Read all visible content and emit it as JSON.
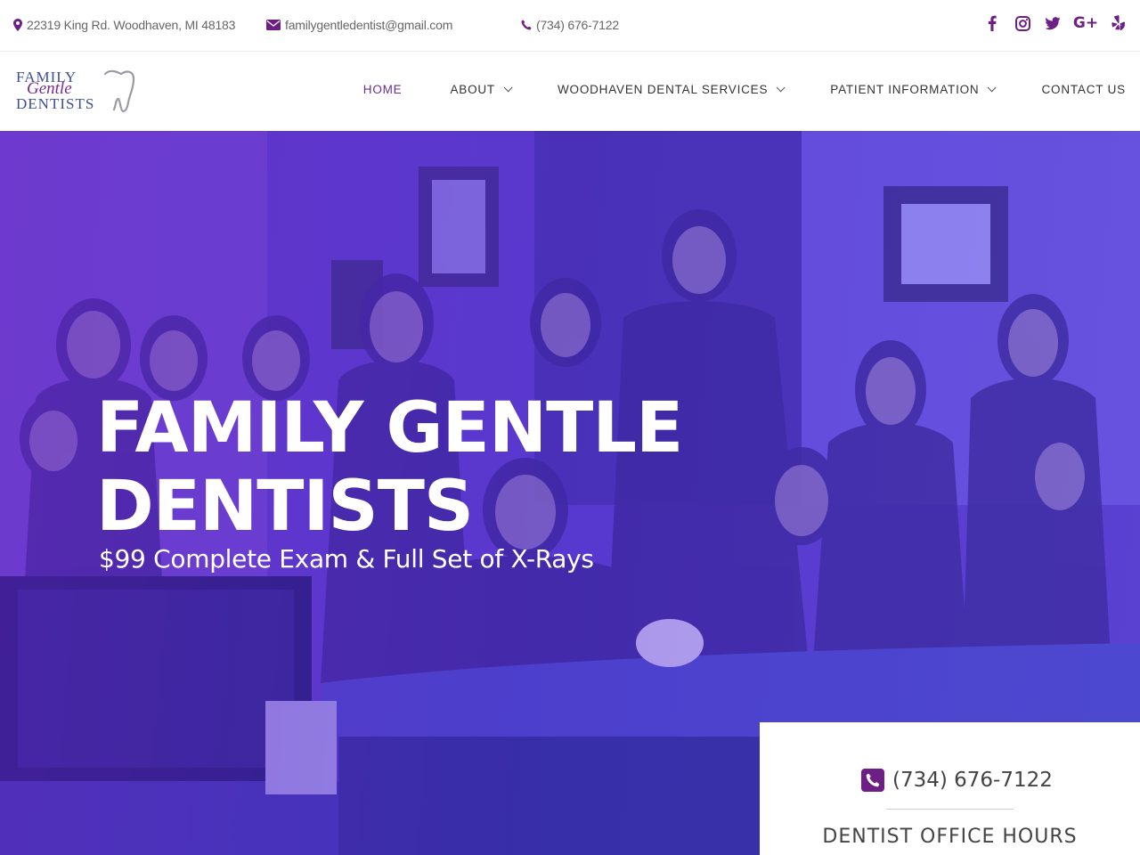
{
  "topbar": {
    "address": "22319 King Rd. Woodhaven, MI 48183",
    "email": "familygentledentist@gmail.com",
    "phone": "(734) 676-7122",
    "icons": {
      "address": "map-marker-icon",
      "email": "envelope-icon",
      "phone": "phone-icon"
    },
    "social": [
      {
        "name": "facebook-icon",
        "glyph": "f"
      },
      {
        "name": "instagram-icon",
        "glyph": ""
      },
      {
        "name": "twitter-icon",
        "glyph": ""
      },
      {
        "name": "google-plus-icon",
        "glyph": "G+"
      },
      {
        "name": "yelp-icon",
        "glyph": ""
      }
    ]
  },
  "logo": {
    "line1": "FAMILY",
    "line2": "Gentle",
    "line3": "DENTISTS"
  },
  "nav": {
    "items": [
      {
        "label": "HOME",
        "active": true,
        "dropdown": false
      },
      {
        "label": "ABOUT",
        "active": false,
        "dropdown": true
      },
      {
        "label": "WOODHAVEN DENTAL SERVICES",
        "active": false,
        "dropdown": true
      },
      {
        "label": "PATIENT INFORMATION",
        "active": false,
        "dropdown": true
      },
      {
        "label": "CONTACT US",
        "active": false,
        "dropdown": false
      }
    ]
  },
  "hero": {
    "title_line1": "FAMILY GENTLE",
    "title_line2": "DENTISTS",
    "subtitle": "$99 Complete Exam & Full Set of X-Rays"
  },
  "card": {
    "phone": "(734) 676-7122",
    "hours_heading": "DENTIST OFFICE HOURS"
  },
  "colors": {
    "brand_purple": "#6d1f86",
    "logo_blue": "#3e4f92",
    "hero_gradient_start": "#6a2fbf",
    "hero_gradient_end": "#5856e8",
    "text_dark": "#333333"
  }
}
